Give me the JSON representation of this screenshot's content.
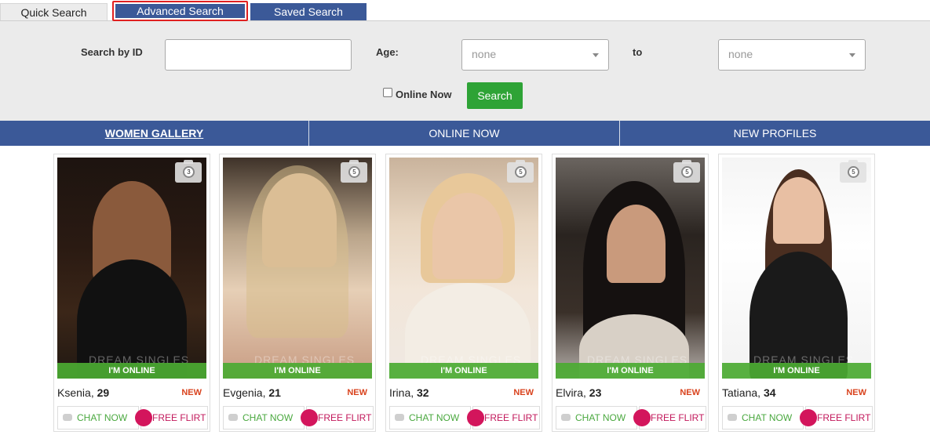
{
  "tabs": {
    "quick": "Quick Search",
    "advanced": "Advanced Search",
    "saved": "Saved Search"
  },
  "search": {
    "id_label": "Search by ID",
    "id_value": "",
    "age_label": "Age:",
    "age_from": "none",
    "to_label": "to",
    "age_to": "none",
    "online_label": "Online Now",
    "online_checked": false,
    "button": "Search"
  },
  "gallery_nav": {
    "women": "WOMEN GALLERY",
    "online": "ONLINE NOW",
    "new": "NEW PROFILES"
  },
  "profiles": [
    {
      "name": "Ksenia",
      "age": "29",
      "photos": "3",
      "status": "I'M ONLINE",
      "badge": "NEW",
      "chat": "CHAT NOW",
      "flirt": "FREE FLIRT",
      "watermark": "DREAM SINGLES"
    },
    {
      "name": "Evgenia",
      "age": "21",
      "photos": "5",
      "status": "I'M ONLINE",
      "badge": "NEW",
      "chat": "CHAT NOW",
      "flirt": "FREE FLIRT",
      "watermark": "DREAM SINGLES"
    },
    {
      "name": "Irina",
      "age": "32",
      "photos": "5",
      "status": "I'M ONLINE",
      "badge": "NEW",
      "chat": "CHAT NOW",
      "flirt": "FREE FLIRT",
      "watermark": "DREAM SINGLES"
    },
    {
      "name": "Elvira",
      "age": "23",
      "photos": "5",
      "status": "I'M ONLINE",
      "badge": "NEW",
      "chat": "CHAT NOW",
      "flirt": "FREE FLIRT",
      "watermark": "DREAM SINGLES"
    },
    {
      "name": "Tatiana",
      "age": "34",
      "photos": "5",
      "status": "I'M ONLINE",
      "badge": "NEW",
      "chat": "CHAT NOW",
      "flirt": "FREE FLIRT",
      "watermark": "DREAM SINGLES"
    }
  ]
}
